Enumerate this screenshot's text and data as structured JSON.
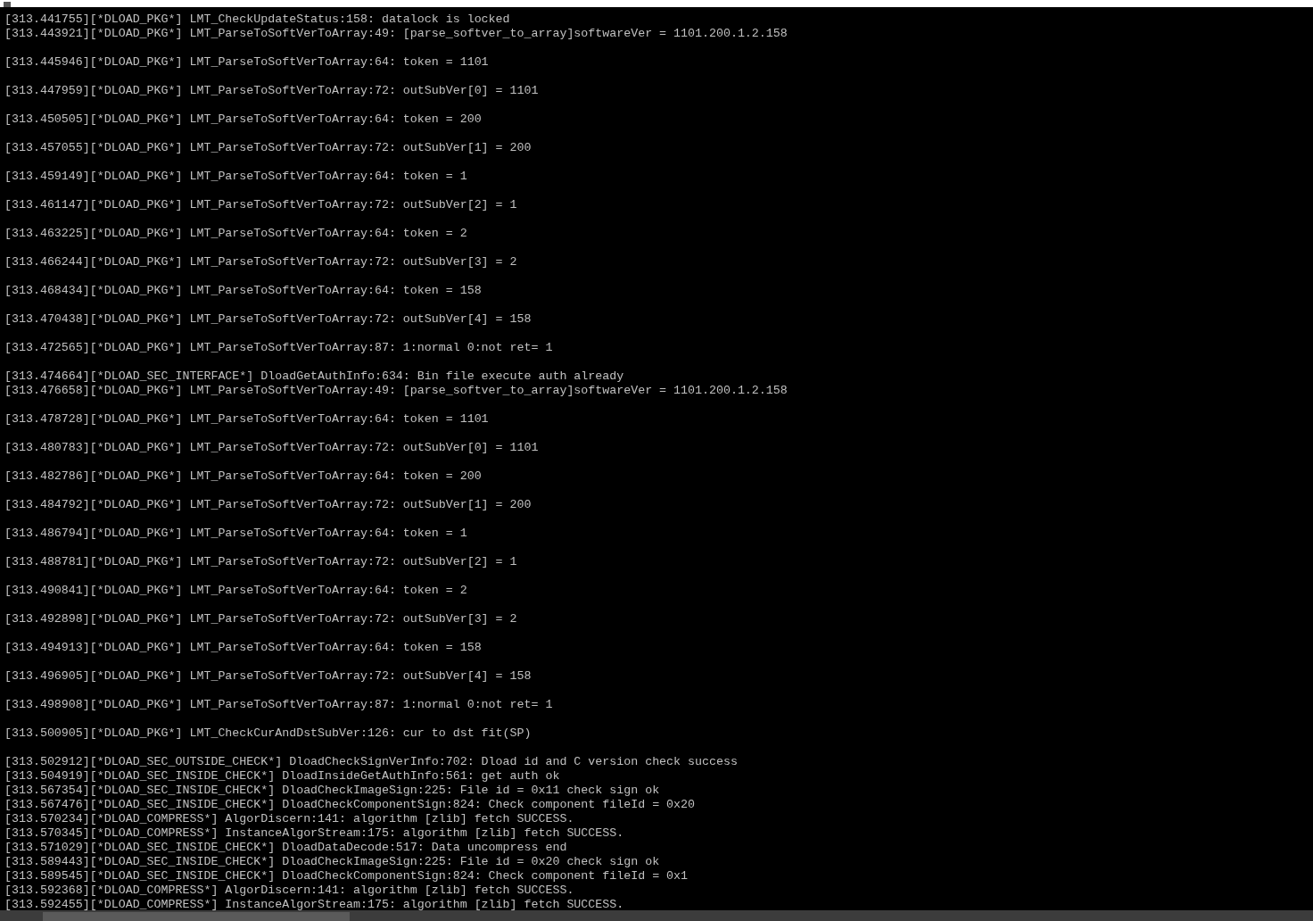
{
  "terminal": {
    "blocks": [
      {
        "lines": [
          "[313.441755][*DLOAD_PKG*] LMT_CheckUpdateStatus:158: datalock is locked",
          "[313.443921][*DLOAD_PKG*] LMT_ParseToSoftVerToArray:49: [parse_softver_to_array]softwareVer = 1101.200.1.2.158"
        ]
      },
      {
        "lines": [
          "[313.445946][*DLOAD_PKG*] LMT_ParseToSoftVerToArray:64: token = 1101"
        ]
      },
      {
        "lines": [
          "[313.447959][*DLOAD_PKG*] LMT_ParseToSoftVerToArray:72: outSubVer[0] = 1101"
        ]
      },
      {
        "lines": [
          "[313.450505][*DLOAD_PKG*] LMT_ParseToSoftVerToArray:64: token = 200"
        ]
      },
      {
        "lines": [
          "[313.457055][*DLOAD_PKG*] LMT_ParseToSoftVerToArray:72: outSubVer[1] = 200"
        ]
      },
      {
        "lines": [
          "[313.459149][*DLOAD_PKG*] LMT_ParseToSoftVerToArray:64: token = 1"
        ]
      },
      {
        "lines": [
          "[313.461147][*DLOAD_PKG*] LMT_ParseToSoftVerToArray:72: outSubVer[2] = 1"
        ]
      },
      {
        "lines": [
          "[313.463225][*DLOAD_PKG*] LMT_ParseToSoftVerToArray:64: token = 2"
        ]
      },
      {
        "lines": [
          "[313.466244][*DLOAD_PKG*] LMT_ParseToSoftVerToArray:72: outSubVer[3] = 2"
        ]
      },
      {
        "lines": [
          "[313.468434][*DLOAD_PKG*] LMT_ParseToSoftVerToArray:64: token = 158"
        ]
      },
      {
        "lines": [
          "[313.470438][*DLOAD_PKG*] LMT_ParseToSoftVerToArray:72: outSubVer[4] = 158"
        ]
      },
      {
        "lines": [
          "[313.472565][*DLOAD_PKG*] LMT_ParseToSoftVerToArray:87: 1:normal 0:not ret= 1"
        ]
      },
      {
        "lines": [
          "[313.474664][*DLOAD_SEC_INTERFACE*] DloadGetAuthInfo:634: Bin file execute auth already",
          "[313.476658][*DLOAD_PKG*] LMT_ParseToSoftVerToArray:49: [parse_softver_to_array]softwareVer = 1101.200.1.2.158"
        ]
      },
      {
        "lines": [
          "[313.478728][*DLOAD_PKG*] LMT_ParseToSoftVerToArray:64: token = 1101"
        ]
      },
      {
        "lines": [
          "[313.480783][*DLOAD_PKG*] LMT_ParseToSoftVerToArray:72: outSubVer[0] = 1101"
        ]
      },
      {
        "lines": [
          "[313.482786][*DLOAD_PKG*] LMT_ParseToSoftVerToArray:64: token = 200"
        ]
      },
      {
        "lines": [
          "[313.484792][*DLOAD_PKG*] LMT_ParseToSoftVerToArray:72: outSubVer[1] = 200"
        ]
      },
      {
        "lines": [
          "[313.486794][*DLOAD_PKG*] LMT_ParseToSoftVerToArray:64: token = 1"
        ]
      },
      {
        "lines": [
          "[313.488781][*DLOAD_PKG*] LMT_ParseToSoftVerToArray:72: outSubVer[2] = 1"
        ]
      },
      {
        "lines": [
          "[313.490841][*DLOAD_PKG*] LMT_ParseToSoftVerToArray:64: token = 2"
        ]
      },
      {
        "lines": [
          "[313.492898][*DLOAD_PKG*] LMT_ParseToSoftVerToArray:72: outSubVer[3] = 2"
        ]
      },
      {
        "lines": [
          "[313.494913][*DLOAD_PKG*] LMT_ParseToSoftVerToArray:64: token = 158"
        ]
      },
      {
        "lines": [
          "[313.496905][*DLOAD_PKG*] LMT_ParseToSoftVerToArray:72: outSubVer[4] = 158"
        ]
      },
      {
        "lines": [
          "[313.498908][*DLOAD_PKG*] LMT_ParseToSoftVerToArray:87: 1:normal 0:not ret= 1"
        ]
      },
      {
        "lines": [
          "[313.500905][*DLOAD_PKG*] LMT_CheckCurAndDstSubVer:126: cur to dst fit(SP)"
        ]
      },
      {
        "lines": [
          "[313.502912][*DLOAD_SEC_OUTSIDE_CHECK*] DloadCheckSignVerInfo:702: Dload id and C version check success",
          "[313.504919][*DLOAD_SEC_INSIDE_CHECK*] DloadInsideGetAuthInfo:561: get auth ok",
          "[313.567354][*DLOAD_SEC_INSIDE_CHECK*] DloadCheckImageSign:225: File id = 0x11 check sign ok",
          "[313.567476][*DLOAD_SEC_INSIDE_CHECK*] DloadCheckComponentSign:824: Check component fileId = 0x20",
          "[313.570234][*DLOAD_COMPRESS*] AlgorDiscern:141: algorithm [zlib] fetch SUCCESS.",
          "[313.570345][*DLOAD_COMPRESS*] InstanceAlgorStream:175: algorithm [zlib] fetch SUCCESS.",
          "[313.571029][*DLOAD_SEC_INSIDE_CHECK*] DloadDataDecode:517: Data uncompress end",
          "[313.589443][*DLOAD_SEC_INSIDE_CHECK*] DloadCheckImageSign:225: File id = 0x20 check sign ok",
          "[313.589545][*DLOAD_SEC_INSIDE_CHECK*] DloadCheckComponentSign:824: Check component fileId = 0x1",
          "[313.592368][*DLOAD_COMPRESS*] AlgorDiscern:141: algorithm [zlib] fetch SUCCESS.",
          "[313.592455][*DLOAD_COMPRESS*] InstanceAlgorStream:175: algorithm [zlib] fetch SUCCESS."
        ]
      }
    ]
  }
}
